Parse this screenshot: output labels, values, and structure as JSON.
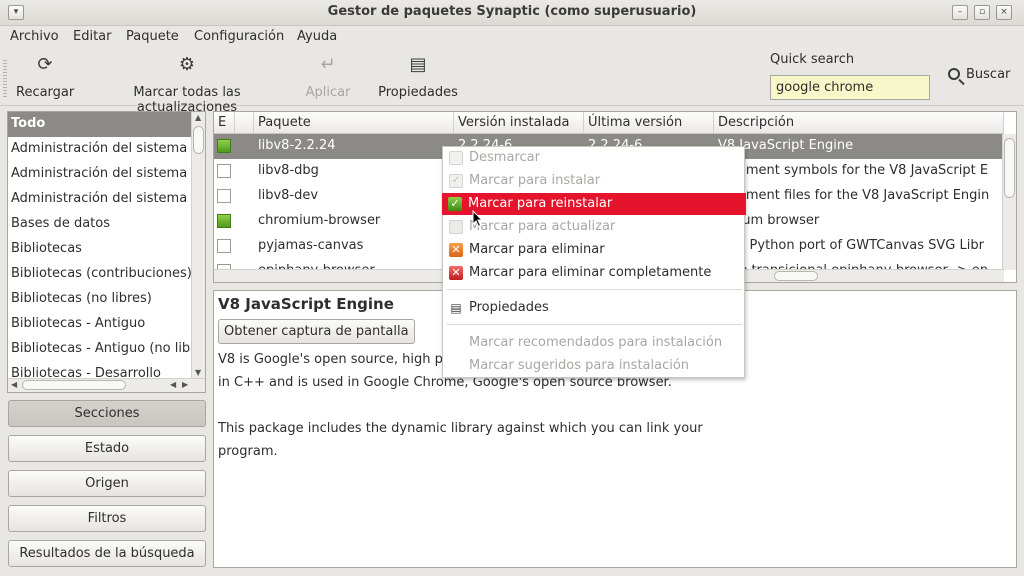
{
  "window": {
    "title": "Gestor de paquetes Synaptic (como superusuario)"
  },
  "menubar": [
    "Archivo",
    "Editar",
    "Paquete",
    "Configuración",
    "Ayuda"
  ],
  "toolbar": {
    "reload": "Recargar",
    "mark_all": "Marcar todas las actualizaciones",
    "apply": "Aplicar",
    "properties": "Propiedades"
  },
  "search": {
    "label": "Quick search",
    "value": "google chrome",
    "button": "Buscar"
  },
  "sections": [
    "Todo",
    "Administración del sistema",
    "Administración del sistema (",
    "Administración del sistema (",
    "Bases de datos",
    "Bibliotecas",
    "Bibliotecas (contribuciones)",
    "Bibliotecas (no libres)",
    "Bibliotecas - Antiguo",
    "Bibliotecas - Antiguo (no libre",
    "Bibliotecas - Desarrollo"
  ],
  "side_buttons": [
    "Secciones",
    "Estado",
    "Origen",
    "Filtros",
    "Resultados de la búsqueda"
  ],
  "table": {
    "columns": [
      "E",
      "",
      "Paquete",
      "Versión instalada",
      "Última versión",
      "Descripción"
    ],
    "rows": [
      {
        "status": "installed",
        "name": "libv8-2.2.24",
        "installed": "2.2.24-6",
        "latest": "2.2.24-6",
        "desc": "V8 JavaScript Engine"
      },
      {
        "status": "none",
        "name": "libv8-dbg",
        "installed": "",
        "latest": "",
        "desc": "elopment symbols for the V8 JavaScript E"
      },
      {
        "status": "none",
        "name": "libv8-dev",
        "installed": "",
        "latest": "",
        "desc": "elopment files for the V8 JavaScript Engin"
      },
      {
        "status": "installed",
        "name": "chromium-browser",
        "installed": "",
        "latest": "",
        "desc": "omium browser"
      },
      {
        "status": "none",
        "name": "pyjamas-canvas",
        "installed": "",
        "latest": "",
        "desc": "mas Python port of GWTCanvas SVG Libr"
      },
      {
        "status": "none",
        "name": "epiphany-browser",
        "installed": "",
        "latest": "",
        "desc": "uete transicional epiphany-browser -> ep"
      }
    ]
  },
  "details": {
    "title": "V8 JavaScript Engine",
    "screenshot_button": "Obtener captura de pantalla",
    "lines": [
      "V8 is Google's open source, high pe",
      "in C++ and is used in Google Chrome, Google's open source browser.",
      "",
      "This package includes the dynamic library against which you can link your",
      "program."
    ]
  },
  "context_menu": [
    {
      "label": "Desmarcar",
      "state": "disabled",
      "icon": "unmark-icon"
    },
    {
      "label": "Marcar para instalar",
      "state": "disabled",
      "icon": "install-icon"
    },
    {
      "label": "Marcar para reinstalar",
      "state": "highlight",
      "icon": "reinstall-icon"
    },
    {
      "label": "Marcar para actualizar",
      "state": "disabled",
      "icon": "upgrade-icon"
    },
    {
      "label": "Marcar para eliminar",
      "state": "enabled",
      "icon": "remove-icon"
    },
    {
      "label": "Marcar para eliminar completamente",
      "state": "enabled",
      "icon": "purge-icon"
    },
    {
      "label": "Propiedades",
      "state": "enabled",
      "icon": "properties-icon"
    },
    {
      "label": "Marcar recomendados para instalación",
      "state": "disabled",
      "icon": ""
    },
    {
      "label": "Marcar sugeridos para instalación",
      "state": "disabled",
      "icon": ""
    }
  ],
  "colors": {
    "selection": "#8b8a87",
    "menu_highlight": "#e5142c",
    "installed_green": "#5aa823",
    "search_bg": "#f7f7c9"
  }
}
